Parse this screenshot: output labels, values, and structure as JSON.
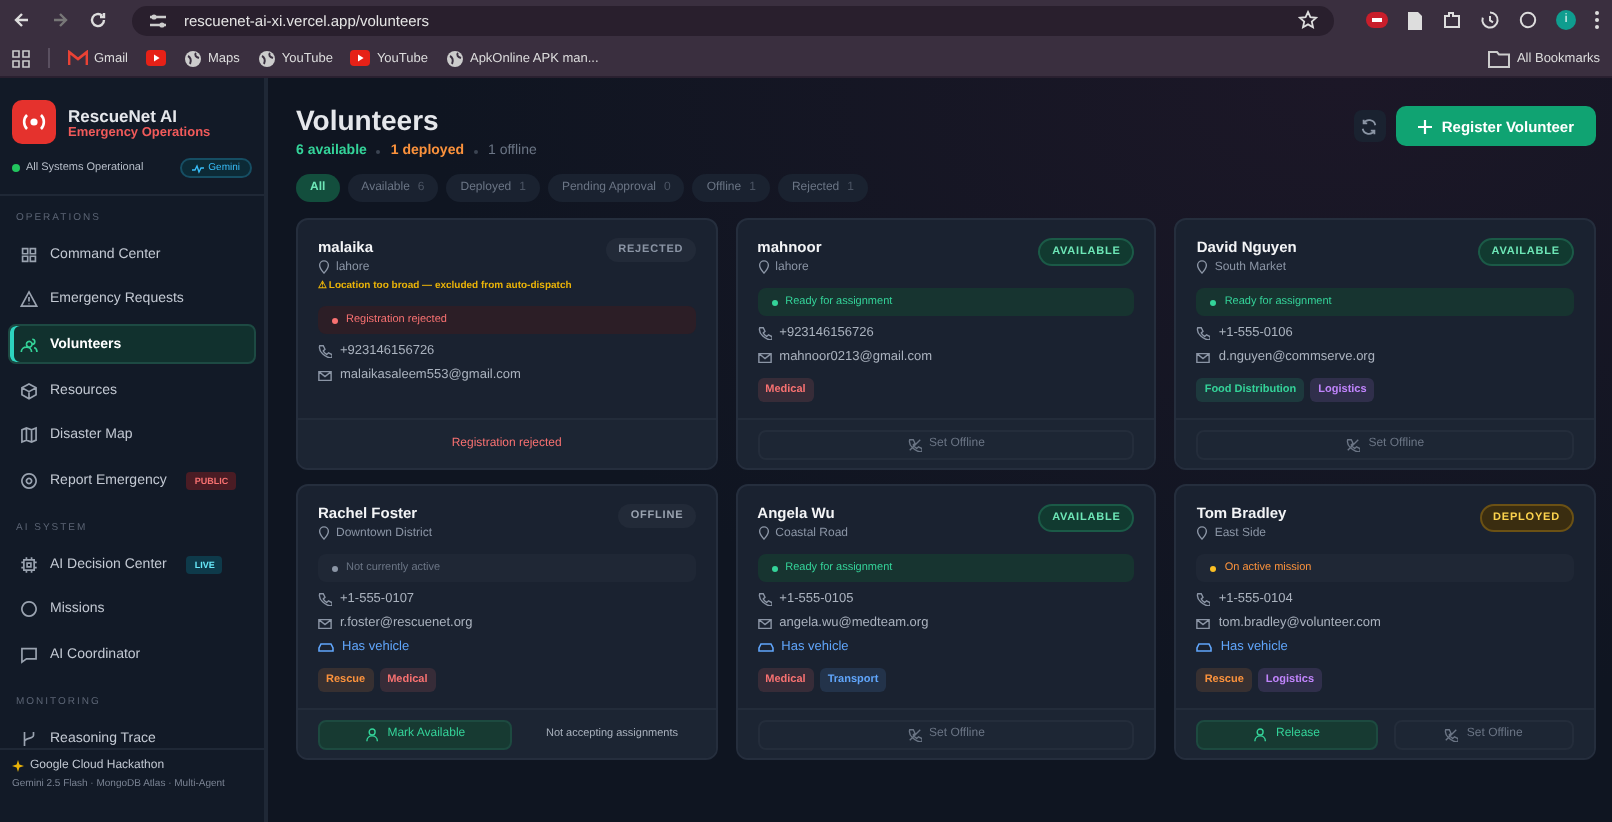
{
  "browser": {
    "url": "rescuenet-ai-xi.vercel.app/volunteers",
    "bookmarks": [
      {
        "label": "Gmail",
        "kind": "gmail"
      },
      {
        "kind": "youtube"
      },
      {
        "label": "Maps",
        "kind": "globe"
      },
      {
        "label": "YouTube",
        "kind": "globe"
      },
      {
        "label": "YouTube",
        "kind": "youtube"
      },
      {
        "label": "ApkOnline APK man...",
        "kind": "globe"
      }
    ],
    "all_bookmarks": "All Bookmarks",
    "profile": "i"
  },
  "sidebar": {
    "brand": "RescueNet AI",
    "subtitle": "Emergency Operations",
    "status": "All Systems Operational",
    "model_badge": "Gemini",
    "sections": [
      {
        "heading": "OPERATIONS",
        "items": [
          {
            "label": "Command Center",
            "selected": false
          },
          {
            "label": "Emergency Requests",
            "selected": false
          },
          {
            "label": "Volunteers",
            "selected": true
          },
          {
            "label": "Resources",
            "selected": false
          },
          {
            "label": "Disaster Map",
            "selected": false
          },
          {
            "label": "Report Emergency",
            "selected": false,
            "badge": {
              "text": "PUBLIC",
              "kind": "red"
            }
          }
        ]
      },
      {
        "heading": "AI SYSTEM",
        "items": [
          {
            "label": "AI Decision Center",
            "selected": false,
            "badge": {
              "text": "LIVE",
              "kind": "cyan"
            }
          },
          {
            "label": "Missions",
            "selected": false
          },
          {
            "label": "AI Coordinator",
            "selected": false
          }
        ]
      },
      {
        "heading": "MONITORING",
        "items": [
          {
            "label": "Reasoning Trace",
            "selected": false
          }
        ]
      }
    ],
    "footer": {
      "title": "Google Cloud Hackathon",
      "subtitle": "Gemini 2.5 Flash · MongoDB Atlas · Multi-Agent"
    }
  },
  "page": {
    "title": "Volunteers",
    "counts": [
      {
        "text": "6 available",
        "kind": "available"
      },
      {
        "text": "1 deployed",
        "kind": "deployed"
      },
      {
        "text": "1 offline",
        "kind": "offline"
      }
    ],
    "filters": [
      {
        "label": "All",
        "selected": true
      },
      {
        "label": "Available",
        "count": "6",
        "selected": false
      },
      {
        "label": "Deployed",
        "count": "1",
        "selected": false
      },
      {
        "label": "Pending Approval",
        "count": "0",
        "selected": false
      },
      {
        "label": "Offline",
        "count": "1",
        "selected": false
      },
      {
        "label": "Rejected",
        "count": "1",
        "selected": false
      }
    ],
    "register_button": "Register Volunteer"
  },
  "cards": [
    {
      "name": "malaika",
      "location": "lahore",
      "warning": "⚠ Location too broad — excluded from auto-dispatch",
      "kind": "rejected",
      "badge": "REJECTED",
      "status_line": "Registration rejected",
      "phone": "+923146156726",
      "email": "malaikasaleem553@gmail.com",
      "footer": [
        {
          "kind": "note",
          "label": "Registration rejected"
        }
      ]
    },
    {
      "name": "mahnoor",
      "location": "lahore",
      "kind": "available",
      "badge": "AVAILABLE",
      "status_line": "Ready for assignment",
      "phone": "+923146156726",
      "email": "mahnoor0213@gmail.com",
      "tags": [
        {
          "label": "Medical",
          "color": "#f87171"
        }
      ],
      "footer": [
        {
          "kind": "ghost",
          "label": "Set Offline"
        }
      ]
    },
    {
      "name": "David Nguyen",
      "location": "South Market",
      "kind": "available",
      "badge": "AVAILABLE",
      "status_line": "Ready for assignment",
      "phone": "+1-555-0106",
      "email": "d.nguyen@commserve.org",
      "tags": [
        {
          "label": "Food Distribution",
          "color": "#34d399"
        },
        {
          "label": "Logistics",
          "color": "#c084fc"
        }
      ],
      "footer": [
        {
          "kind": "ghost",
          "label": "Set Offline"
        }
      ]
    },
    {
      "name": "Rachel Foster",
      "location": "Downtown District",
      "kind": "offline",
      "badge": "OFFLINE",
      "status_line": "Not currently active",
      "phone": "+1-555-0107",
      "email": "r.foster@rescuenet.org",
      "vehicle": "Has vehicle",
      "tags": [
        {
          "label": "Rescue",
          "color": "#fb923c"
        },
        {
          "label": "Medical",
          "color": "#f87171"
        }
      ],
      "footer": [
        {
          "kind": "primary",
          "label": "Mark Available"
        },
        {
          "kind": "text",
          "label": "Not accepting assignments"
        }
      ]
    },
    {
      "name": "Angela Wu",
      "location": "Coastal Road",
      "kind": "available",
      "badge": "AVAILABLE",
      "status_line": "Ready for assignment",
      "phone": "+1-555-0105",
      "email": "angela.wu@medteam.org",
      "vehicle": "Has vehicle",
      "tags": [
        {
          "label": "Medical",
          "color": "#f87171"
        },
        {
          "label": "Transport",
          "color": "#60a5fa"
        }
      ],
      "footer": [
        {
          "kind": "ghost",
          "label": "Set Offline"
        }
      ]
    },
    {
      "name": "Tom Bradley",
      "location": "East Side",
      "kind": "deployed",
      "badge": "DEPLOYED",
      "status_line": "On active mission",
      "phone": "+1-555-0104",
      "email": "tom.bradley@volunteer.com",
      "vehicle": "Has vehicle",
      "tags": [
        {
          "label": "Rescue",
          "color": "#fb923c"
        },
        {
          "label": "Logistics",
          "color": "#c084fc"
        }
      ],
      "footer": [
        {
          "kind": "primary",
          "label": "Release"
        },
        {
          "kind": "ghost",
          "label": "Set Offline"
        }
      ]
    }
  ]
}
